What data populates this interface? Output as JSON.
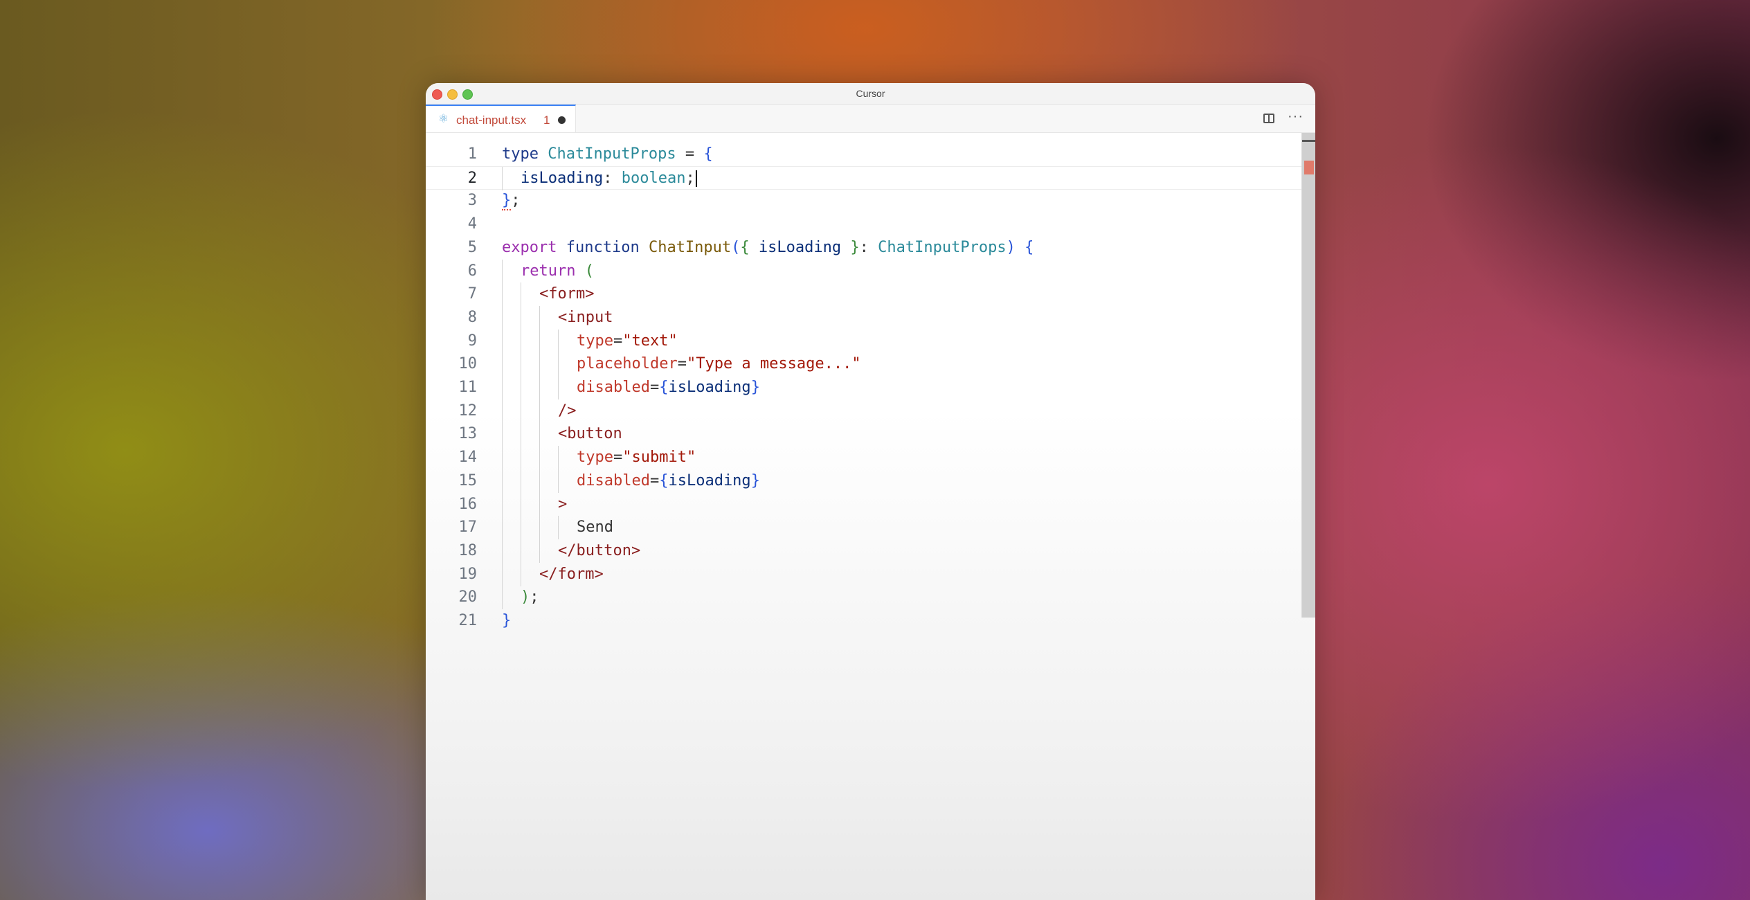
{
  "window": {
    "title": "Cursor"
  },
  "tab": {
    "icon": "react-icon",
    "label": "chat-input.tsx",
    "problem_count": "1"
  },
  "code_lines": [
    {
      "n": "1",
      "indent": 0,
      "tokens": [
        [
          "kw",
          "type"
        ],
        [
          "plain",
          " "
        ],
        [
          "type",
          "ChatInputProps"
        ],
        [
          "plain",
          " = "
        ],
        [
          "brace1",
          "{"
        ]
      ]
    },
    {
      "n": "2",
      "indent": 1,
      "current": true,
      "tokens": [
        [
          "var",
          "isLoading"
        ],
        [
          "plain",
          ": "
        ],
        [
          "type",
          "boolean"
        ],
        [
          "plain",
          ";"
        ]
      ]
    },
    {
      "n": "3",
      "indent": 0,
      "tokens": [
        [
          "brace1",
          "}"
        ],
        [
          "plain",
          ";"
        ]
      ]
    },
    {
      "n": "4",
      "indent": 0,
      "tokens": []
    },
    {
      "n": "5",
      "indent": 0,
      "tokens": [
        [
          "purple",
          "export"
        ],
        [
          "plain",
          " "
        ],
        [
          "kw",
          "function"
        ],
        [
          "plain",
          " "
        ],
        [
          "fn",
          "ChatInput"
        ],
        [
          "brace1",
          "("
        ],
        [
          "brace2",
          "{"
        ],
        [
          "plain",
          " "
        ],
        [
          "var",
          "isLoading"
        ],
        [
          "plain",
          " "
        ],
        [
          "brace2",
          "}"
        ],
        [
          "plain",
          ": "
        ],
        [
          "type",
          "ChatInputProps"
        ],
        [
          "brace1",
          ")"
        ],
        [
          "plain",
          " "
        ],
        [
          "brace1",
          "{"
        ]
      ]
    },
    {
      "n": "6",
      "indent": 1,
      "tokens": [
        [
          "purple",
          "return"
        ],
        [
          "plain",
          " "
        ],
        [
          "brace2",
          "("
        ]
      ]
    },
    {
      "n": "7",
      "indent": 2,
      "tokens": [
        [
          "tag",
          "<form>"
        ]
      ]
    },
    {
      "n": "8",
      "indent": 3,
      "tokens": [
        [
          "tag",
          "<input"
        ]
      ]
    },
    {
      "n": "9",
      "indent": 4,
      "tokens": [
        [
          "attr",
          "type"
        ],
        [
          "plain",
          "="
        ],
        [
          "str",
          "\"text\""
        ]
      ]
    },
    {
      "n": "10",
      "indent": 4,
      "tokens": [
        [
          "attr",
          "placeholder"
        ],
        [
          "plain",
          "="
        ],
        [
          "str",
          "\"Type a message...\""
        ]
      ]
    },
    {
      "n": "11",
      "indent": 4,
      "tokens": [
        [
          "attr",
          "disabled"
        ],
        [
          "plain",
          "="
        ],
        [
          "brace1",
          "{"
        ],
        [
          "var",
          "isLoading"
        ],
        [
          "brace1",
          "}"
        ]
      ]
    },
    {
      "n": "12",
      "indent": 3,
      "tokens": [
        [
          "tag",
          "/>"
        ]
      ]
    },
    {
      "n": "13",
      "indent": 3,
      "tokens": [
        [
          "tag",
          "<button"
        ]
      ]
    },
    {
      "n": "14",
      "indent": 4,
      "tokens": [
        [
          "attr",
          "type"
        ],
        [
          "plain",
          "="
        ],
        [
          "str",
          "\"submit\""
        ]
      ]
    },
    {
      "n": "15",
      "indent": 4,
      "tokens": [
        [
          "attr",
          "disabled"
        ],
        [
          "plain",
          "="
        ],
        [
          "brace1",
          "{"
        ],
        [
          "var",
          "isLoading"
        ],
        [
          "brace1",
          "}"
        ]
      ]
    },
    {
      "n": "16",
      "indent": 3,
      "tokens": [
        [
          "tag",
          ">"
        ]
      ]
    },
    {
      "n": "17",
      "indent": 4,
      "tokens": [
        [
          "plain",
          "Send"
        ]
      ]
    },
    {
      "n": "18",
      "indent": 3,
      "tokens": [
        [
          "tag",
          "</button>"
        ]
      ]
    },
    {
      "n": "19",
      "indent": 2,
      "tokens": [
        [
          "tag",
          "</form>"
        ]
      ]
    },
    {
      "n": "20",
      "indent": 1,
      "tokens": [
        [
          "brace2",
          ")"
        ],
        [
          "plain",
          ";"
        ]
      ]
    },
    {
      "n": "21",
      "indent": 0,
      "tokens": [
        [
          "brace1",
          "}"
        ]
      ]
    }
  ]
}
